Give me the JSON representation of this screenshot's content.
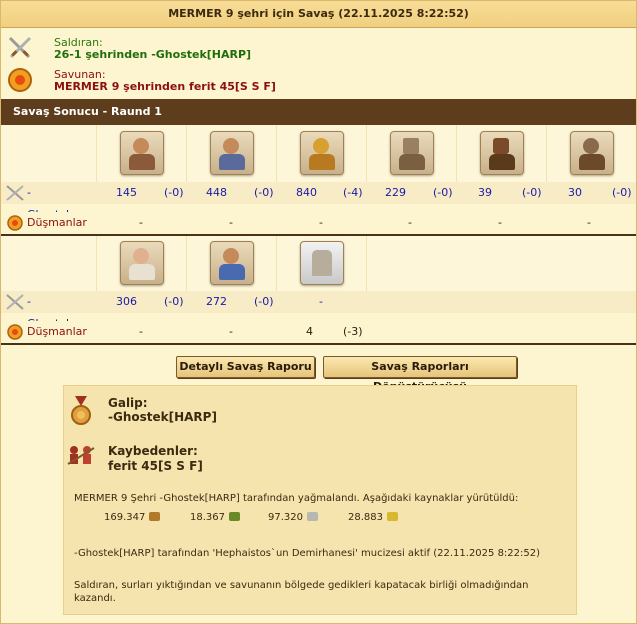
{
  "header": {
    "title": "MERMER 9 şehri için Savaş (22.11.2025 8:22:52)"
  },
  "attacker": {
    "label": "Saldıran:",
    "from": "26-1 şehrinden -Ghostek[HARP]",
    "icon": "crossed-swords-icon"
  },
  "defender": {
    "label": "Savunan:",
    "from": "MERMER 9 şehrinden ferit 45[S S F]",
    "icon": "round-shield-icon"
  },
  "round_title": "Savaş Sonucu - Raund 1",
  "block1": {
    "units": [
      "swordsman-icon",
      "slinger-icon",
      "hoplite-icon",
      "catapult-icon",
      "ram-icon",
      "ballista-icon"
    ],
    "attacker_name": "-Ghostek",
    "attacker_stats": [
      {
        "value": "145",
        "loss": "(-0)"
      },
      {
        "value": "448",
        "loss": "(-0)"
      },
      {
        "value": "840",
        "loss": "(-4)"
      },
      {
        "value": "229",
        "loss": "(-0)"
      },
      {
        "value": "39",
        "loss": "(-0)"
      },
      {
        "value": "30",
        "loss": "(-0)"
      }
    ],
    "enemy_name": "Düşmanlar",
    "enemy_stats": [
      "-",
      "-",
      "-",
      "-",
      "-",
      "-"
    ]
  },
  "block2": {
    "units": [
      "cook-icon",
      "doctor-icon",
      "wall-icon"
    ],
    "attacker_name": "-Ghostek",
    "attacker_stats": [
      {
        "value": "306",
        "loss": "(-0)"
      },
      {
        "value": "272",
        "loss": "(-0)"
      },
      {
        "value": "-",
        "loss": ""
      }
    ],
    "enemy_name": "Düşmanlar",
    "enemy_stats": [
      {
        "value": "-",
        "loss": ""
      },
      {
        "value": "-",
        "loss": ""
      },
      {
        "value": "4",
        "loss": "(-3)"
      }
    ]
  },
  "buttons": {
    "detailed": "Detaylı Savaş Raporu",
    "converter": "Savaş Raporları Dönüştürücüsü"
  },
  "summary": {
    "winner_label": "Galip:",
    "winner": "-Ghostek[HARP]",
    "losers_label": "Kaybedenler:",
    "loser": "ferit 45[S S F]",
    "plunder_text": "MERMER 9 Şehri -Ghostek[HARP] tarafından yağmalandı. Aşağıdaki kaynaklar yürütüldü:",
    "resources": [
      {
        "amount": "169.347",
        "icon": "wood-icon",
        "color": "#b07a2a"
      },
      {
        "amount": "18.367",
        "icon": "wine-icon",
        "color": "#6a8a2a"
      },
      {
        "amount": "97.320",
        "icon": "marble-icon",
        "color": "#b8b8b0"
      },
      {
        "amount": "28.883",
        "icon": "sulfur-icon",
        "color": "#d8b830"
      }
    ],
    "miracle_text": "-Ghostek[HARP] tarafından 'Hephaistos`un Demirhanesi' mucizesi aktif (22.11.2025 8:22:52)",
    "wall_text": "Saldıran, surları yıktığından ve savunanın bölgede gedikleri kapatacak birliği olmadığından kazandı."
  }
}
